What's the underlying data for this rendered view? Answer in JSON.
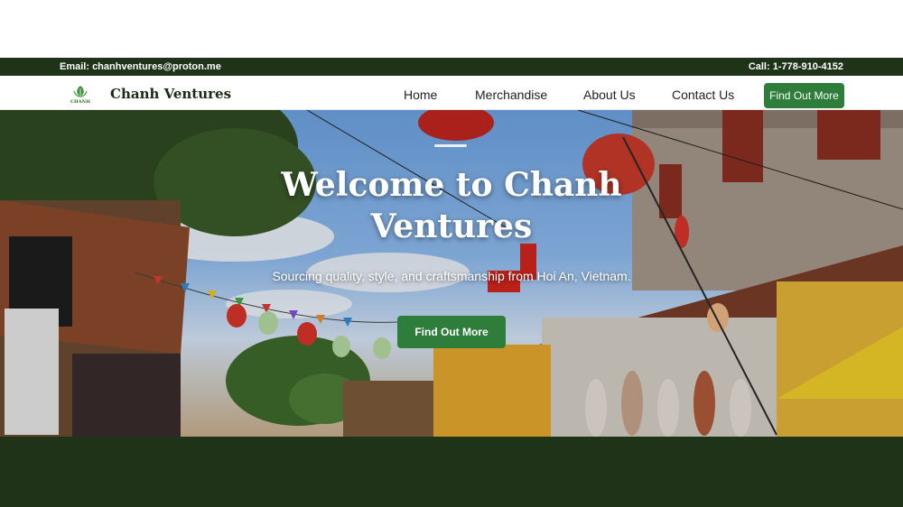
{
  "topbar": {
    "email": "Email: chanhventures@proton.me",
    "phone": "Call: 1-778-910-4152"
  },
  "header": {
    "brand": "Chanh Ventures",
    "logo_text": "CHANH",
    "nav": {
      "home": "Home",
      "merchandise": "Merchandise",
      "about": "About Us",
      "contact": "Contact Us"
    },
    "cta": "Find Out More"
  },
  "hero": {
    "title": "Welcome to Chanh Ventures",
    "subtitle": "Sourcing quality, style, and craftsmanship from Hoi An, Vietnam.",
    "cta": "Find Out More"
  },
  "colors": {
    "dark_green": "#1f3319",
    "button_green": "#2e7d3b"
  }
}
